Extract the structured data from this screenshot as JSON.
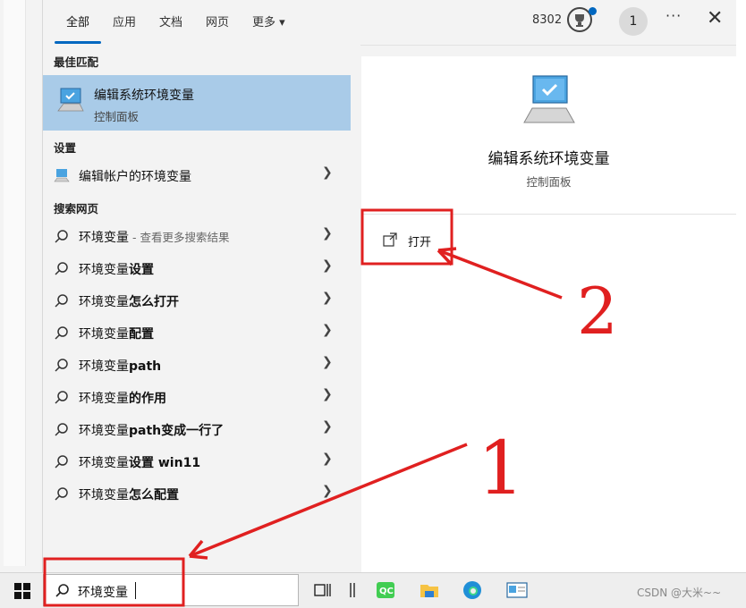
{
  "tabs": [
    {
      "label": "全部",
      "active": true
    },
    {
      "label": "应用"
    },
    {
      "label": "文档"
    },
    {
      "label": "网页"
    },
    {
      "label": "更多"
    }
  ],
  "header": {
    "points": "8302",
    "avatar_text": "1"
  },
  "left": {
    "best_match_title": "最佳匹配",
    "best_match": {
      "title": "编辑系统环境变量",
      "subtitle": "控制面板"
    },
    "settings_title": "设置",
    "settings_item": "编辑帐户的环境变量",
    "web_title": "搜索网页",
    "web_items": [
      {
        "query": "环境变量",
        "suffix": " - 查看更多搜索结果"
      },
      {
        "prefix": "环境变量",
        "bold": "设置"
      },
      {
        "prefix": "环境变量",
        "bold": "怎么打开"
      },
      {
        "prefix": "环境变量",
        "bold": "配置"
      },
      {
        "prefix": "环境变量",
        "bold": "path"
      },
      {
        "prefix": "环境变量",
        "bold": "的作用"
      },
      {
        "prefix": "环境变量",
        "bold": "path变成一行了"
      },
      {
        "prefix": "环境变量",
        "bold": "设置 win11"
      },
      {
        "prefix": "环境变量",
        "bold": "怎么配置"
      }
    ]
  },
  "right": {
    "title": "编辑系统环境变量",
    "subtitle": "控制面板",
    "open_label": "打开"
  },
  "taskbar": {
    "search_text": "环境变量",
    "watermark": "CSDN @大米~~"
  },
  "annotations": {
    "label_1": "1",
    "label_2": "2"
  },
  "colors": {
    "highlight": "#a9cbe8",
    "accent": "#0067c0",
    "annotation": "#e02020"
  }
}
